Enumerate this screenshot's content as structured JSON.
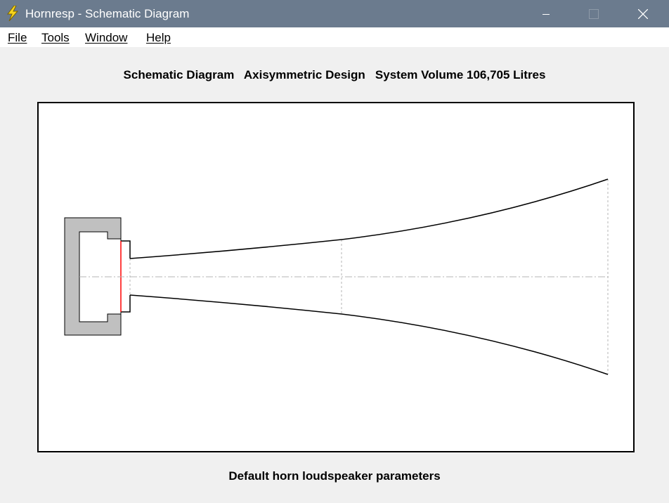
{
  "window": {
    "title": "Hornresp - Schematic Diagram",
    "icon": "lightning-bolt-icon",
    "controls": [
      "minimize-icon",
      "maximize-icon",
      "close-icon"
    ]
  },
  "menu": {
    "file": "File",
    "tools": "Tools",
    "window": "Window",
    "help": "Help"
  },
  "header": {
    "text": "Schematic Diagram   Axisymmetric Design   System Volume 106,705 Litres"
  },
  "footer": {
    "text": "Default horn loudspeaker parameters"
  },
  "colors": {
    "titlebar": "#6b7b8e",
    "chamber_fill": "#c0c0c0",
    "driver_line": "#ff0000",
    "guide_line": "#b4b4b4",
    "outline": "#000000"
  }
}
